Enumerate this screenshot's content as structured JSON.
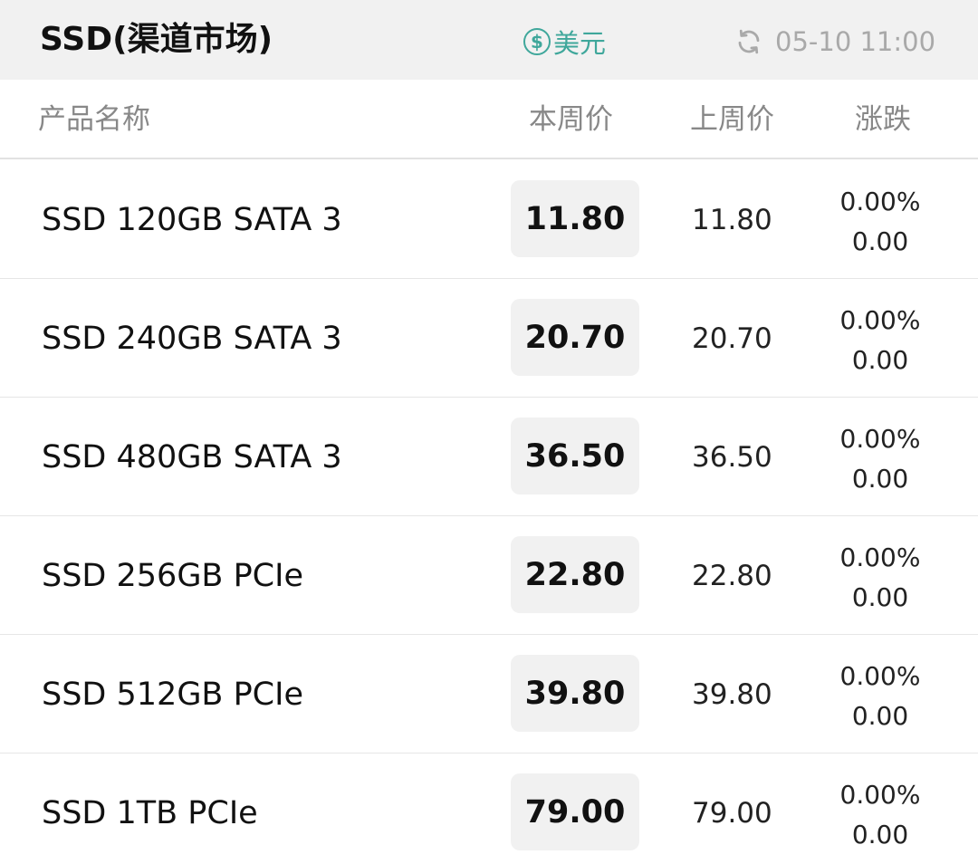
{
  "header": {
    "title": "SSD(渠道市场)",
    "currency_symbol": "$",
    "currency_label": "美元",
    "update_time": "05-10 11:00",
    "accent_color": "#3fa79b"
  },
  "columns": {
    "name": "产品名称",
    "this_week": "本周价",
    "last_week": "上周价",
    "change": "涨跌"
  },
  "rows": [
    {
      "name": "SSD 120GB SATA 3",
      "this_week": "11.80",
      "last_week": "11.80",
      "change_pct": "0.00%",
      "change_abs": "0.00"
    },
    {
      "name": "SSD 240GB SATA 3",
      "this_week": "20.70",
      "last_week": "20.70",
      "change_pct": "0.00%",
      "change_abs": "0.00"
    },
    {
      "name": "SSD 480GB SATA 3",
      "this_week": "36.50",
      "last_week": "36.50",
      "change_pct": "0.00%",
      "change_abs": "0.00"
    },
    {
      "name": "SSD 256GB PCIe",
      "this_week": "22.80",
      "last_week": "22.80",
      "change_pct": "0.00%",
      "change_abs": "0.00"
    },
    {
      "name": "SSD 512GB PCIe",
      "this_week": "39.80",
      "last_week": "39.80",
      "change_pct": "0.00%",
      "change_abs": "0.00"
    },
    {
      "name": "SSD 1TB PCIe",
      "this_week": "79.00",
      "last_week": "79.00",
      "change_pct": "0.00%",
      "change_abs": "0.00"
    }
  ]
}
